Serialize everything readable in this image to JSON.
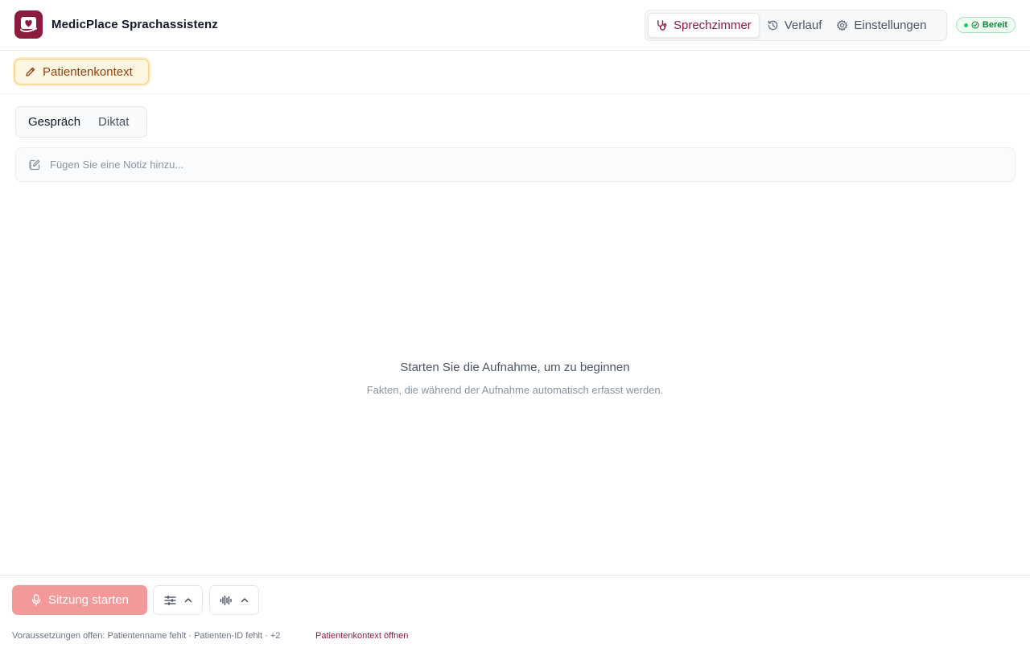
{
  "app": {
    "title": "MedicPlace Sprachassistenz"
  },
  "nav": {
    "tabs": [
      {
        "label": "Sprechzimmer",
        "icon": "stethoscope-icon",
        "active": true
      },
      {
        "label": "Verlauf",
        "icon": "history-icon",
        "active": false
      },
      {
        "label": "Einstellungen",
        "icon": "gear-icon",
        "active": false
      }
    ]
  },
  "status": {
    "label": "Bereit",
    "color": "#15803d"
  },
  "context": {
    "button_label": "Patientenkontext"
  },
  "mode": {
    "tabs": [
      "Gespräch",
      "Diktat"
    ],
    "active": "Gespräch"
  },
  "note": {
    "placeholder": "Fügen Sie eine Notiz hinzu...",
    "value": ""
  },
  "empty_state": {
    "title": "Starten Sie die Aufnahme, um zu beginnen",
    "subtitle": "Fakten, die während der Aufnahme automatisch erfasst werden."
  },
  "footer": {
    "start_label": "Sitzung starten",
    "prerequisites": "Voraussetzungen offen: Patientenname fehlt · Patienten-ID fehlt · +2",
    "open_context_link": "Patientenkontext öffnen"
  },
  "colors": {
    "brand": "#8c1c3e",
    "accent_disabled": "#f29a9a",
    "warning": "#92400e"
  }
}
